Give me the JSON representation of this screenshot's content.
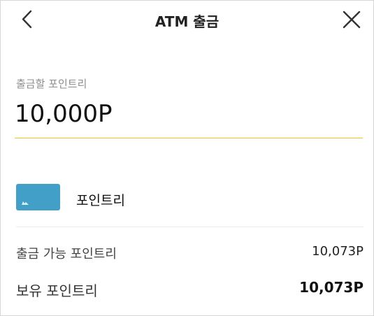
{
  "header": {
    "title": "ATM 출금",
    "back_icon": "chevron-left-icon",
    "close_icon": "close-icon"
  },
  "amount": {
    "label": "출금할 포인트리",
    "value": "10,000P"
  },
  "account": {
    "name": "포인트리",
    "icon": "card-icon",
    "color": "#42a0c8"
  },
  "info": {
    "available_label": "출금 가능 포인트리",
    "available_value": "10,073P",
    "owned_label": "보유 포인트리",
    "owned_value": "10,073P"
  },
  "colors": {
    "accent_underline": "#f0c418"
  }
}
